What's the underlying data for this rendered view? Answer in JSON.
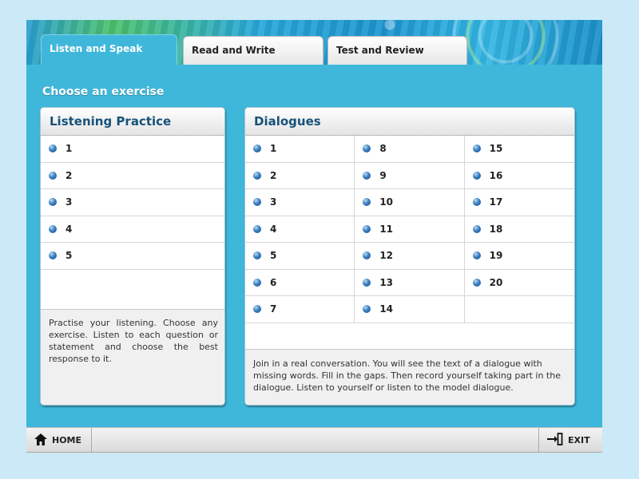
{
  "tabs": [
    {
      "label": "Listen and Speak",
      "active": true
    },
    {
      "label": "Read and Write",
      "active": false
    },
    {
      "label": "Test and Review",
      "active": false
    }
  ],
  "main": {
    "heading": "Choose an exercise"
  },
  "listening": {
    "title": "Listening Practice",
    "items": [
      "1",
      "2",
      "3",
      "4",
      "5"
    ],
    "description": "Practise your listening. Choose any exercise. Listen to each question or statement and choose the best response to it."
  },
  "dialogues": {
    "title": "Dialogues",
    "columns": [
      [
        "1",
        "2",
        "3",
        "4",
        "5",
        "6",
        "7"
      ],
      [
        "8",
        "9",
        "10",
        "11",
        "12",
        "13",
        "14"
      ],
      [
        "15",
        "16",
        "17",
        "18",
        "19",
        "20"
      ]
    ],
    "description": "Join in a real conversation. You will see the text of a dialogue with missing words. Fill in the gaps. Then record yourself taking part in the dialogue. Listen to yourself or listen to the model dialogue."
  },
  "footer": {
    "home_label": "HOME",
    "exit_label": "EXIT"
  },
  "icons": {
    "bullet": "blue-dot-icon",
    "home": "house-icon",
    "exit": "exit-arrow-icon"
  },
  "colors": {
    "accent": "#3fb7da",
    "panel_title": "#17527a",
    "bullet": "#2b6cb0"
  }
}
